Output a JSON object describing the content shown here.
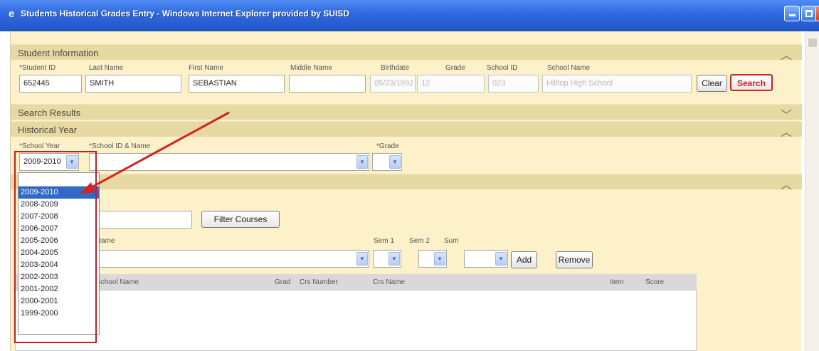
{
  "window": {
    "title": "Students Historical Grades Entry - Windows Internet Explorer provided by SUISD",
    "icon": "ie-icon"
  },
  "student_info": {
    "section_title": "Student Information",
    "labels": {
      "student_id": "*Student ID",
      "last_name": "Last Name",
      "first_name": "First Name",
      "middle_name": "Middle Name",
      "birthdate": "Birthdate",
      "grade": "Grade",
      "school_id": "School ID",
      "school_name": "School Name"
    },
    "values": {
      "student_id": "652445",
      "last_name": "SMITH",
      "first_name": "SEBASTIAN",
      "middle_name": "",
      "birthdate": "05/23/1992",
      "grade": "12",
      "school_id": "023",
      "school_name": "Hilltop High School"
    },
    "clear_label": "Clear",
    "search_label": "Search"
  },
  "search_results": {
    "section_title": "Search Results"
  },
  "historical_year": {
    "section_title": "Historical Year",
    "school_year_label": "*School Year",
    "school_id_name_label": "*School ID & Name",
    "grade_label": "*Grade",
    "school_year_value": "2009-2010"
  },
  "courses": {
    "name_label_fragment": "me",
    "filter_label": "Filter Courses",
    "crs_name_label_fragment": "s Name",
    "sem1_label": "Sem 1",
    "sem2_label": "Sem 2",
    "sum_label": "Sum",
    "add_label": "Add",
    "remove_label": "Remove"
  },
  "grid": {
    "headers": [
      "School Name",
      "Grad",
      "Crs Number",
      "Crs Name",
      "Item",
      "Score"
    ]
  },
  "school_year_dropdown": {
    "options": [
      "2009-2010",
      "2008-2009",
      "2007-2008",
      "2006-2007",
      "2005-2006",
      "2004-2005",
      "2003-2004",
      "2002-2003",
      "2001-2002",
      "2000-2001",
      "1999-2000"
    ],
    "selected": "2009-2010"
  },
  "colors": {
    "panel_bg": "#fcf1c9",
    "band_bg": "#e7d9a2",
    "highlight": "#3169c6",
    "annotation_red": "#c41f1f"
  }
}
